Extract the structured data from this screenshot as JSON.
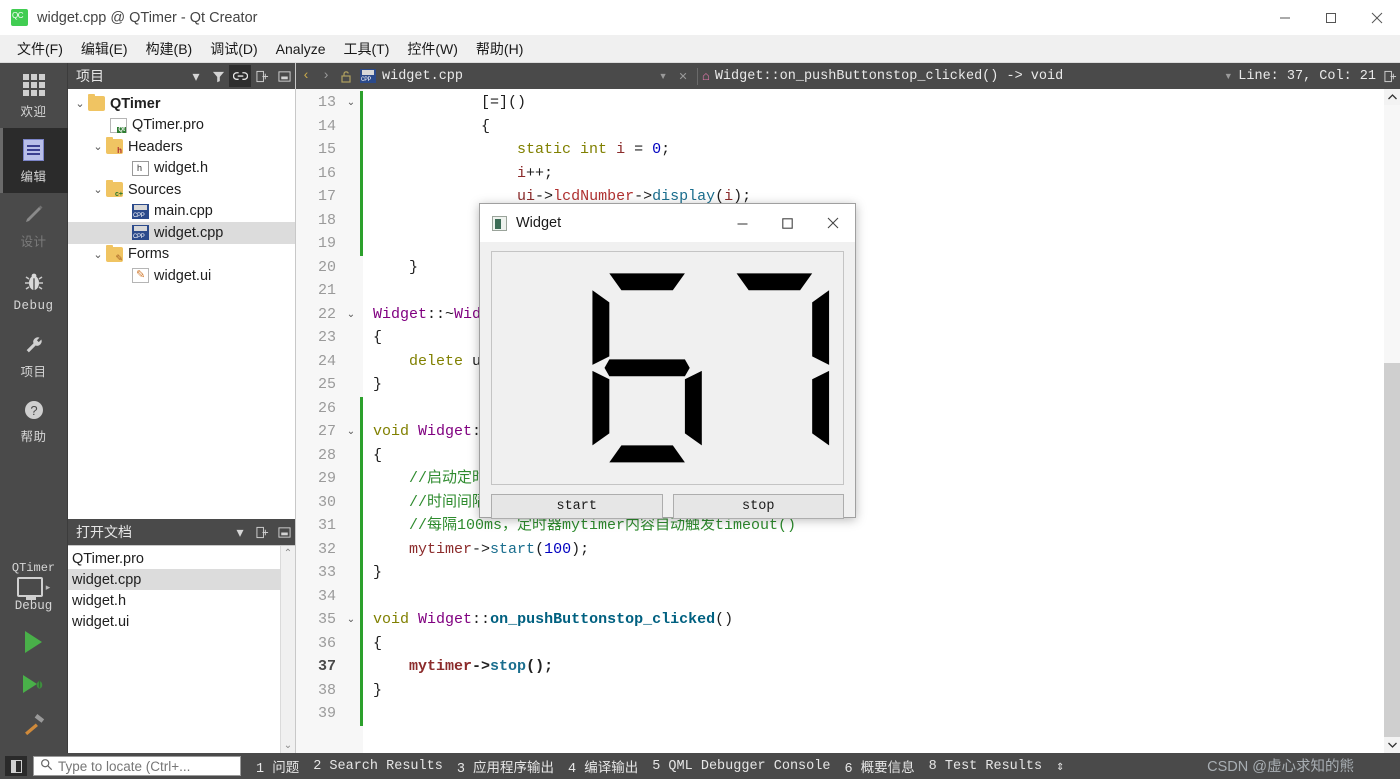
{
  "window": {
    "title": "widget.cpp @ QTimer - Qt Creator",
    "icon": "qt-creator-icon",
    "minimize": "–",
    "maximize": "□",
    "close": "✕"
  },
  "menubar": {
    "items": [
      {
        "label": "文件(F)",
        "mnemonic": "F"
      },
      {
        "label": "编辑(E)",
        "mnemonic": "E"
      },
      {
        "label": "构建(B)",
        "mnemonic": "B"
      },
      {
        "label": "调试(D)",
        "mnemonic": "D"
      },
      {
        "label": "Analyze",
        "mnemonic": "A"
      },
      {
        "label": "工具(T)",
        "mnemonic": "T"
      },
      {
        "label": "控件(W)",
        "mnemonic": "W"
      },
      {
        "label": "帮助(H)",
        "mnemonic": "H"
      }
    ]
  },
  "activity_bar": {
    "items": [
      {
        "label": "欢迎",
        "icon": "grid-icon",
        "state": "normal"
      },
      {
        "label": "编辑",
        "icon": "document-icon",
        "state": "selected"
      },
      {
        "label": "设计",
        "icon": "pencil-icon",
        "state": "disabled"
      },
      {
        "label": "Debug",
        "icon": "bug-icon",
        "state": "normal"
      },
      {
        "label": "项目",
        "icon": "wrench-icon",
        "state": "normal"
      },
      {
        "label": "帮助",
        "icon": "question-icon",
        "state": "normal"
      }
    ],
    "kit": {
      "project": "QTimer",
      "mode": "Debug",
      "icon": "monitor-icon",
      "arrow": "▸"
    },
    "run_buttons": [
      {
        "name": "run-button",
        "icon": "play-icon"
      },
      {
        "name": "debug-button",
        "icon": "play-bug-icon"
      },
      {
        "name": "build-button",
        "icon": "hammer-icon"
      }
    ]
  },
  "project_dock": {
    "title": "项目",
    "header_buttons": [
      {
        "name": "dropdown",
        "icon": "chevron-down-icon"
      },
      {
        "name": "filter",
        "icon": "filter-icon"
      },
      {
        "name": "sync-with-editor",
        "icon": "link-icon",
        "active": true
      },
      {
        "name": "split",
        "icon": "split-icon"
      },
      {
        "name": "close-pane",
        "icon": "minimize-pane-icon"
      }
    ],
    "tree": [
      {
        "label": "QTimer",
        "icon": "qt-project-icon",
        "indent": 0,
        "expanded": true,
        "bold": true,
        "selected": false
      },
      {
        "label": "QTimer.pro",
        "icon": "pro-file-icon",
        "indent": 1,
        "expanded": null,
        "bold": false,
        "selected": false
      },
      {
        "label": "Headers",
        "icon": "headers-folder-icon",
        "indent": 1,
        "expanded": true,
        "bold": false,
        "selected": false
      },
      {
        "label": "widget.h",
        "icon": "header-file-icon",
        "indent": 2,
        "expanded": null,
        "bold": false,
        "selected": false
      },
      {
        "label": "Sources",
        "icon": "sources-folder-icon",
        "indent": 1,
        "expanded": true,
        "bold": false,
        "selected": false
      },
      {
        "label": "main.cpp",
        "icon": "cpp-file-icon",
        "indent": 2,
        "expanded": null,
        "bold": false,
        "selected": false
      },
      {
        "label": "widget.cpp",
        "icon": "cpp-file-icon",
        "indent": 2,
        "expanded": null,
        "bold": false,
        "selected": true
      },
      {
        "label": "Forms",
        "icon": "forms-folder-icon",
        "indent": 1,
        "expanded": true,
        "bold": false,
        "selected": false
      },
      {
        "label": "widget.ui",
        "icon": "ui-file-icon",
        "indent": 2,
        "expanded": null,
        "bold": false,
        "selected": false
      }
    ]
  },
  "open_documents": {
    "title": "打开文档",
    "header_buttons": [
      {
        "name": "dropdown",
        "icon": "chevron-down-icon"
      },
      {
        "name": "split",
        "icon": "split-icon"
      },
      {
        "name": "close-pane",
        "icon": "minimize-pane-icon"
      }
    ],
    "items": [
      {
        "label": "QTimer.pro",
        "selected": false
      },
      {
        "label": "widget.cpp",
        "selected": true
      },
      {
        "label": "widget.h",
        "selected": false
      },
      {
        "label": "widget.ui",
        "selected": false
      }
    ],
    "scroll_up": "⌃",
    "scroll_down": "⌄"
  },
  "editor_toolbar": {
    "back": "‹",
    "forward": "›",
    "lock_icon": "unlock-icon",
    "file_icon": "cpp-file-icon",
    "filename": "widget.cpp",
    "file_dropdown": "▾",
    "close": "✕",
    "symbol_icon": "function-icon",
    "symbol": "Widget::on_pushButtonstop_clicked() -> void",
    "symbol_dropdown": "▾",
    "cursor_position": "Line: 37, Col: 21",
    "split_icon": "split-editor-icon"
  },
  "code": {
    "first_line": 13,
    "current_line": 37,
    "lines": [
      {
        "n": 13,
        "fold": "⌄",
        "changed": true,
        "html": "            <span class='k-op'>[=]()</span>"
      },
      {
        "n": 14,
        "fold": "",
        "changed": true,
        "html": "            {"
      },
      {
        "n": 15,
        "fold": "",
        "changed": true,
        "html": "                <span class='k-kw'>static int</span> <span class='k-var'>i</span> = <span class='k-num'>0</span>;"
      },
      {
        "n": 16,
        "fold": "",
        "changed": true,
        "html": "                <span class='k-var'>i</span>++;"
      },
      {
        "n": 17,
        "fold": "",
        "changed": true,
        "html": "                <span class='k-var'>ui</span>-&gt;<span class='k-mem'>lcdNumber</span>-&gt;<span class='k-call'>display</span>(<span class='k-var'>i</span>);"
      },
      {
        "n": 18,
        "fold": "",
        "changed": true,
        "html": ""
      },
      {
        "n": 19,
        "fold": "",
        "changed": true,
        "html": ""
      },
      {
        "n": 20,
        "fold": "",
        "changed": false,
        "html": "    }"
      },
      {
        "n": 21,
        "fold": "",
        "changed": false,
        "html": ""
      },
      {
        "n": 22,
        "fold": "⌄",
        "changed": false,
        "html": "<span class='k-cls'>Widget</span>::~<span class='k-cls'>Widget</span>()"
      },
      {
        "n": 23,
        "fold": "",
        "changed": false,
        "html": "{"
      },
      {
        "n": 24,
        "fold": "",
        "changed": false,
        "html": "    <span class='k-kw'>delete</span> ui;"
      },
      {
        "n": 25,
        "fold": "",
        "changed": false,
        "html": "}"
      },
      {
        "n": 26,
        "fold": "",
        "changed": true,
        "html": ""
      },
      {
        "n": 27,
        "fold": "⌄",
        "changed": true,
        "html": "<span class='k-kw'>void</span> <span class='k-cls'>Widget</span>::<span class='k-fn'>on_pushButtonstart_clicked</span>()"
      },
      {
        "n": 28,
        "fold": "",
        "changed": true,
        "html": "{"
      },
      {
        "n": 29,
        "fold": "",
        "changed": true,
        "html": "    <span class='k-cm'>//启动定时器</span>"
      },
      {
        "n": 30,
        "fold": "",
        "changed": true,
        "html": "    <span class='k-cm'>//时间间隔100ms</span>"
      },
      {
        "n": 31,
        "fold": "",
        "changed": true,
        "html": "    <span class='k-cm'>//每隔100ms，定时器mytimer内容自动触发timeout()</span>"
      },
      {
        "n": 32,
        "fold": "",
        "changed": true,
        "html": "    <span class='k-var'>mytimer</span>-&gt;<span class='k-call'>start</span>(<span class='k-num'>100</span>);"
      },
      {
        "n": 33,
        "fold": "",
        "changed": true,
        "html": "}"
      },
      {
        "n": 34,
        "fold": "",
        "changed": true,
        "html": ""
      },
      {
        "n": 35,
        "fold": "⌄",
        "changed": true,
        "html": "<span class='k-kw'>void</span> <span class='k-cls'>Widget</span>::<span class='k-fn'>on_pushButtonstop_clicked</span>()"
      },
      {
        "n": 36,
        "fold": "",
        "changed": true,
        "html": "{"
      },
      {
        "n": 37,
        "fold": "",
        "changed": true,
        "html": "    <span class='k-var'>mytimer</span>-&gt;<span class='k-call'>stop</span>();"
      },
      {
        "n": 38,
        "fold": "",
        "changed": true,
        "html": "}"
      },
      {
        "n": 39,
        "fold": "",
        "changed": true,
        "html": ""
      }
    ]
  },
  "dialog": {
    "title": "Widget",
    "icon": "qt-widget-icon",
    "minimize": "–",
    "maximize": "□",
    "close": "✕",
    "lcd_value": "67",
    "buttons": [
      {
        "label": "start",
        "name": "start-button"
      },
      {
        "label": "stop",
        "name": "stop-button"
      }
    ]
  },
  "statusbar": {
    "sidebar_toggle": "sidebar-toggle-icon",
    "locator": {
      "icon": "search-icon",
      "placeholder": "Type to locate (Ctrl+..."
    },
    "panes": [
      "1 问题",
      "2 Search Results",
      "3 应用程序输出",
      "4 编译输出",
      "5 QML Debugger Console",
      "6 概要信息",
      "8 Test Results"
    ],
    "resize_handle": "⇕",
    "watermark": "CSDN @虚心求知的熊"
  }
}
